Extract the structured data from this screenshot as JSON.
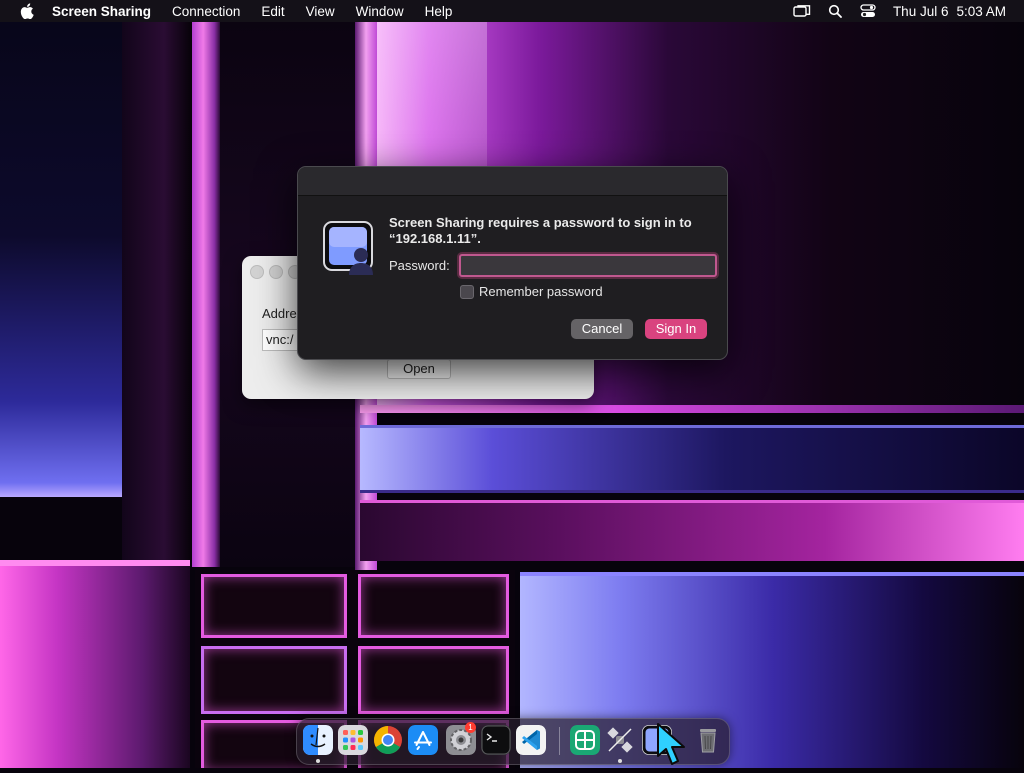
{
  "menubar": {
    "app_name": "Screen Sharing",
    "items": [
      "Connection",
      "Edit",
      "View",
      "Window",
      "Help"
    ],
    "date": "Thu Jul 6",
    "time": "5:03 AM",
    "icons": [
      "apple-logo-icon",
      "screen-mirroring-icon",
      "spotlight-search-icon",
      "control-center-icon"
    ]
  },
  "background_window": {
    "address_label": "Addre",
    "address_value": "vnc:/",
    "open_label": "Open"
  },
  "dialog": {
    "message_line1": "Screen Sharing requires a password to sign in to",
    "message_line2": "“192.168.1.11”.",
    "password_label": "Password:",
    "password_value": "",
    "remember_label": "Remember password",
    "remember_checked": false,
    "cancel_label": "Cancel",
    "signin_label": "Sign In",
    "accent_color": "#d9437f"
  },
  "dock": {
    "apps": [
      "finder",
      "launchpad",
      "chrome",
      "app-store",
      "system-settings",
      "terminal",
      "vscode",
      "separator",
      "chatgpt",
      "satellite-app",
      "screen-sharing",
      "trash"
    ],
    "settings_badge": "1"
  }
}
